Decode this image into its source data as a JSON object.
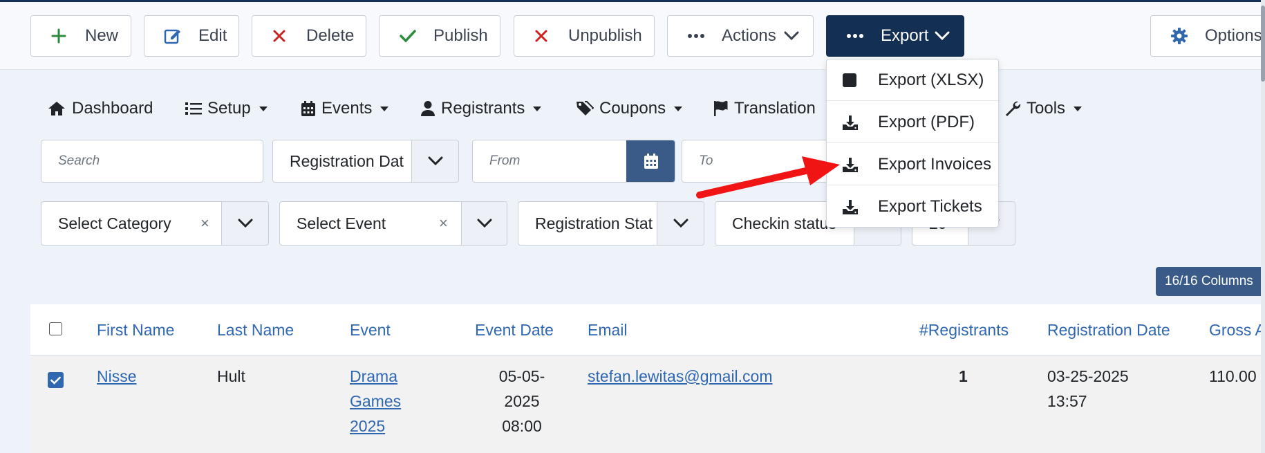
{
  "toolbar": {
    "new_label": "New",
    "edit_label": "Edit",
    "delete_label": "Delete",
    "publish_label": "Publish",
    "unpublish_label": "Unpublish",
    "actions_label": "Actions",
    "export_label": "Export",
    "options_label": "Options"
  },
  "export_menu": {
    "items": [
      {
        "label": "Export (XLSX)",
        "icon": "square-icon"
      },
      {
        "label": "Export (PDF)",
        "icon": "download-icon"
      },
      {
        "label": "Export Invoices",
        "icon": "download-icon"
      },
      {
        "label": "Export Tickets",
        "icon": "download-icon"
      }
    ]
  },
  "nav": {
    "items": [
      {
        "label": "Dashboard",
        "icon": "home-icon"
      },
      {
        "label": "Setup",
        "icon": "list-icon"
      },
      {
        "label": "Events",
        "icon": "calendar-icon"
      },
      {
        "label": "Registrants",
        "icon": "user-icon"
      },
      {
        "label": "Coupons",
        "icon": "tags-icon"
      },
      {
        "label": "Translation",
        "icon": "flag-icon"
      },
      {
        "label": "Tools",
        "icon": "wrench-icon"
      }
    ]
  },
  "filters": {
    "search_placeholder": "Search",
    "date_field_value": "Registration Dat",
    "from_placeholder": "From",
    "to_placeholder": "To",
    "category_value": "Select Category",
    "event_value": "Select Event",
    "status_value": "Registration Stat",
    "checkin_value": "Checkin status",
    "limit_value": "20",
    "clear_glyph": "×"
  },
  "columns_button_label": "16/16 Columns",
  "table": {
    "headers": [
      "First Name",
      "Last Name",
      "Event",
      "Event Date",
      "Email",
      "#Registrants",
      "Registration Date",
      "Gross A"
    ],
    "rows": [
      {
        "first_name": "Nisse",
        "last_name": "Hult",
        "event_line1": "Drama",
        "event_line2": "Games",
        "event_line3": "2025",
        "event_date_line1": "05-05-",
        "event_date_line2": "2025",
        "event_date_line3": "08:00",
        "email": "stefan.lewitas@gmail.com",
        "registrants": "1",
        "reg_date_line1": "03-25-2025",
        "reg_date_line2": "13:57",
        "gross": "110.00",
        "checked": true
      }
    ]
  },
  "colors": {
    "dark_navy": "#132f53",
    "link_blue": "#2f67b0",
    "accent_blue": "#3a5a88",
    "arrow_red": "#f01414"
  }
}
